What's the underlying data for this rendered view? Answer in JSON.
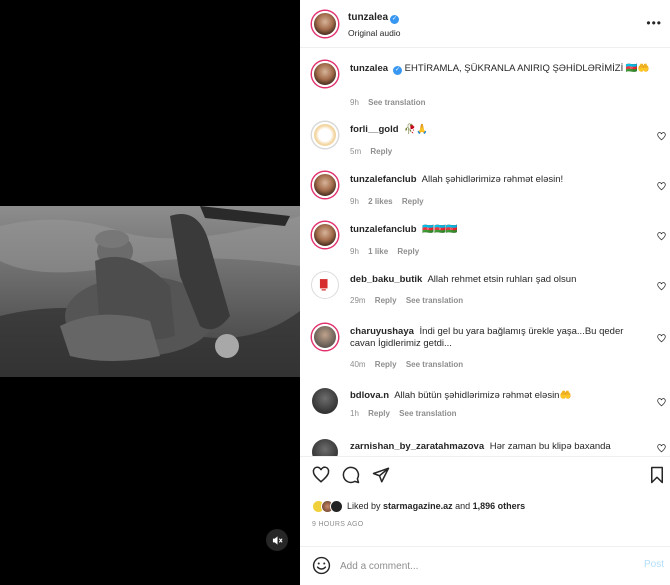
{
  "post": {
    "username": "tunzalea",
    "audio": "Original audio"
  },
  "caption": {
    "username": "tunzalea",
    "text": "EHTİRAMLA, ŞÜKRANLA ANIRIQ ŞƏHİDLƏRİMİZİ 🇦🇿🤲",
    "time": "9h",
    "see_translation": "See translation"
  },
  "comments": [
    {
      "username": "forli__gold",
      "text": "🥀🙏",
      "time": "5m",
      "likes": "",
      "reply": "Reply",
      "see_translation": ""
    },
    {
      "username": "tunzalefanclub",
      "text": "Allah şəhidlərimizə rəhmət eləsin!",
      "time": "9h",
      "likes": "2 likes",
      "reply": "Reply",
      "see_translation": ""
    },
    {
      "username": "tunzalefanclub",
      "text": "🇦🇿🇦🇿🇦🇿",
      "time": "9h",
      "likes": "1 like",
      "reply": "Reply",
      "see_translation": ""
    },
    {
      "username": "deb_baku_butik",
      "text": "Allah rehmet etsin ruhları şad olsun",
      "time": "29m",
      "likes": "",
      "reply": "Reply",
      "see_translation": "See translation"
    },
    {
      "username": "charuyushaya",
      "text": "İndi gel bu yara bağlamış ürekle yaşa...Bu qeder cavan İgidlerimiz getdi...",
      "time": "40m",
      "likes": "",
      "reply": "Reply",
      "see_translation": "See translation"
    },
    {
      "username": "bdlova.n",
      "text": "Allah bütün şəhidlərimizə rəhmət eləsin🤲",
      "time": "1h",
      "likes": "",
      "reply": "Reply",
      "see_translation": "See translation"
    },
    {
      "username": "zarnishan_by_zaratahmazova",
      "text": "Hər zaman bu klipə baxanda",
      "time": "",
      "likes": "",
      "reply": "",
      "see_translation": ""
    }
  ],
  "likes": {
    "prefix": "Liked by",
    "user": "starmagazine.az",
    "and": "and",
    "others": "1,896 others"
  },
  "timestamp": "9 HOURS AGO",
  "composer": {
    "placeholder": "Add a comment...",
    "post_label": "Post"
  },
  "colors": {
    "accent": "#3897f0",
    "post_disabled": "#b2dffc",
    "muted_text": "#8e8e8e",
    "text": "#262626"
  },
  "icons": {
    "more": "more-options-icon",
    "like": "heart-icon",
    "comment": "comment-icon",
    "share": "share-icon",
    "save": "bookmark-icon",
    "emoji": "emoji-icon",
    "mute": "muted-speaker-icon"
  }
}
